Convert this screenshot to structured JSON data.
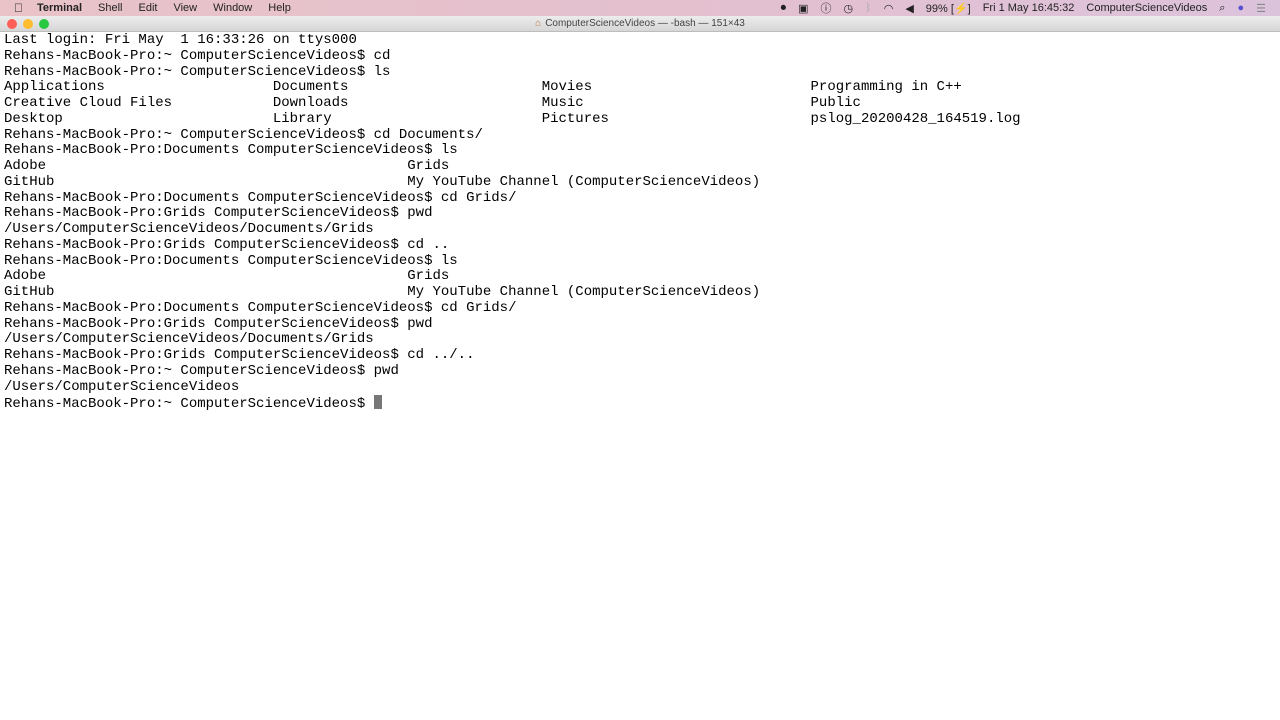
{
  "menubar": {
    "app": "Terminal",
    "items": [
      "Shell",
      "Edit",
      "View",
      "Window",
      "Help"
    ],
    "battery": "99%",
    "datetime": "Fri 1 May  16:45:32",
    "user": "ComputerScienceVideos"
  },
  "window": {
    "title": "ComputerScienceVideos — -bash — 151×43"
  },
  "terminal": {
    "lines": [
      "Last login: Fri May  1 16:33:26 on ttys000",
      "Rehans-MacBook-Pro:~ ComputerScienceVideos$ cd",
      "Rehans-MacBook-Pro:~ ComputerScienceVideos$ ls",
      "Applications                    Documents                       Movies                          Programming in C++",
      "Creative Cloud Files            Downloads                       Music                           Public",
      "Desktop                         Library                         Pictures                        pslog_20200428_164519.log",
      "Rehans-MacBook-Pro:~ ComputerScienceVideos$ cd Documents/",
      "Rehans-MacBook-Pro:Documents ComputerScienceVideos$ ls",
      "Adobe                                           Grids",
      "GitHub                                          My YouTube Channel (ComputerScienceVideos)",
      "Rehans-MacBook-Pro:Documents ComputerScienceVideos$ cd Grids/",
      "Rehans-MacBook-Pro:Grids ComputerScienceVideos$ pwd",
      "/Users/ComputerScienceVideos/Documents/Grids",
      "Rehans-MacBook-Pro:Grids ComputerScienceVideos$ cd ..",
      "Rehans-MacBook-Pro:Documents ComputerScienceVideos$ ls",
      "Adobe                                           Grids",
      "GitHub                                          My YouTube Channel (ComputerScienceVideos)",
      "Rehans-MacBook-Pro:Documents ComputerScienceVideos$ cd Grids/",
      "Rehans-MacBook-Pro:Grids ComputerScienceVideos$ pwd",
      "/Users/ComputerScienceVideos/Documents/Grids",
      "Rehans-MacBook-Pro:Grids ComputerScienceVideos$ cd ../..",
      "Rehans-MacBook-Pro:~ ComputerScienceVideos$ pwd",
      "/Users/ComputerScienceVideos"
    ],
    "prompt": "Rehans-MacBook-Pro:~ ComputerScienceVideos$ "
  }
}
